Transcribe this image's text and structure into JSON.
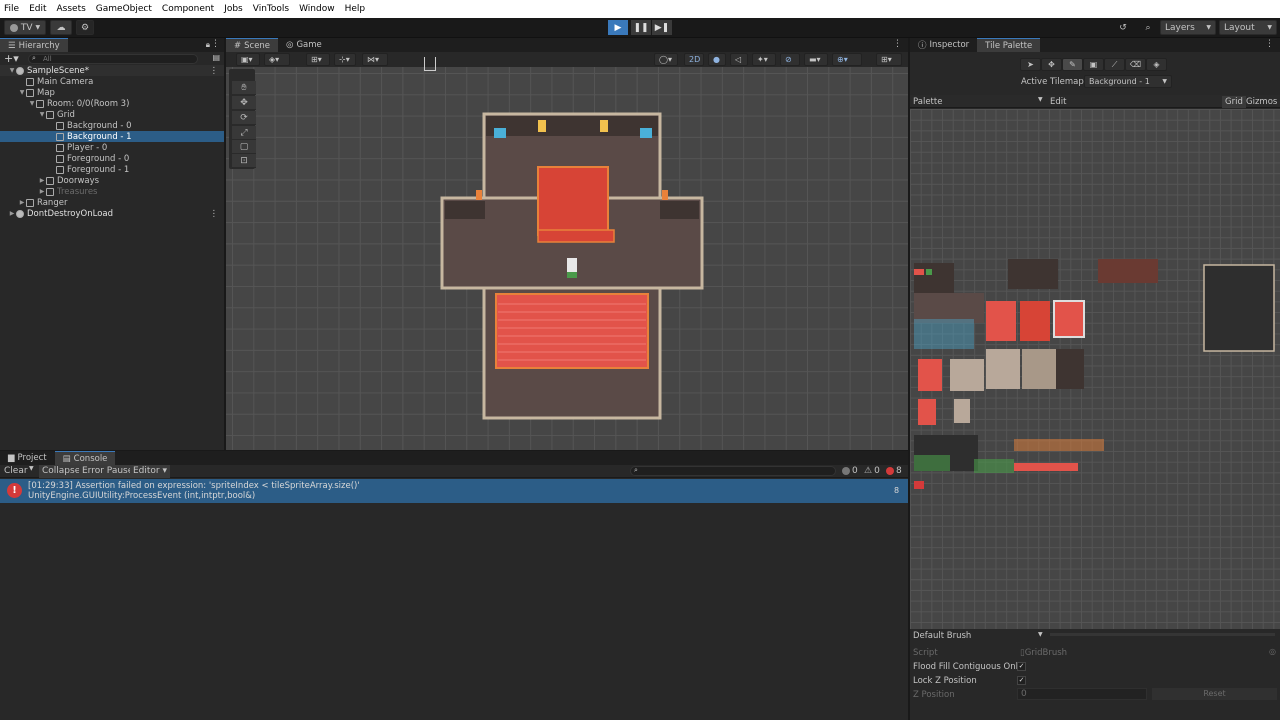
{
  "menu": [
    "File",
    "Edit",
    "Assets",
    "GameObject",
    "Component",
    "Jobs",
    "VinTools",
    "Window",
    "Help"
  ],
  "toolbar": {
    "account": "TV",
    "layers": "Layers",
    "layout": "Layout"
  },
  "hierarchy": {
    "tab": "Hierarchy",
    "search_placeholder": "All",
    "items": [
      {
        "label": "SampleScene*",
        "depth": 0,
        "kind": "scene",
        "expanded": true
      },
      {
        "label": "Main Camera",
        "depth": 1,
        "kind": "obj"
      },
      {
        "label": "Map",
        "depth": 1,
        "kind": "obj",
        "expanded": true
      },
      {
        "label": "Room: 0/0(Room 3)",
        "depth": 2,
        "kind": "obj",
        "expanded": true
      },
      {
        "label": "Grid",
        "depth": 3,
        "kind": "obj",
        "expanded": true
      },
      {
        "label": "Background - 0",
        "depth": 4,
        "kind": "obj"
      },
      {
        "label": "Background - 1",
        "depth": 4,
        "kind": "obj",
        "selected": true
      },
      {
        "label": "Player - 0",
        "depth": 4,
        "kind": "obj"
      },
      {
        "label": "Foreground - 0",
        "depth": 4,
        "kind": "obj"
      },
      {
        "label": "Foreground - 1",
        "depth": 4,
        "kind": "obj"
      },
      {
        "label": "Doorways",
        "depth": 3,
        "kind": "obj",
        "collapsed": true
      },
      {
        "label": "Treasures",
        "depth": 3,
        "kind": "obj",
        "collapsed": true,
        "dim": true
      },
      {
        "label": "Ranger",
        "depth": 1,
        "kind": "obj",
        "collapsed": true
      },
      {
        "label": "DontDestroyOnLoad",
        "depth": 0,
        "kind": "scene",
        "collapsed": true
      }
    ]
  },
  "scene": {
    "tabs": [
      "Scene",
      "Game"
    ],
    "mode_2d": "2D"
  },
  "console": {
    "tabs": [
      "Project",
      "Console"
    ],
    "buttons": [
      "Clear",
      "Collapse",
      "Error Pause",
      "Editor"
    ],
    "counts": {
      "log": "0",
      "warn": "0",
      "error": "8"
    },
    "message_line1": "[01:29:33] Assertion failed on expression: 'spriteIndex < tileSpriteArray.size()'",
    "message_line2": "UnityEngine.GUIUtility:ProcessEvent (int,intptr,bool&)",
    "message_count": "8"
  },
  "inspector": {
    "tabs": [
      "Inspector",
      "Tile Palette"
    ],
    "active_tilemap_label": "Active Tilemap",
    "active_tilemap_value": "Background - 1",
    "palette_label": "Palette",
    "edit_label": "Edit",
    "grid_label": "Grid",
    "gizmos_label": "Gizmos",
    "brush": "Default Brush",
    "script_label": "Script",
    "script_value": "GridBrush",
    "flood_label": "Flood Fill Contiguous Only",
    "lockz_label": "Lock Z Position",
    "zpos_label": "Z Position",
    "zpos_value": "0",
    "reset_label": "Reset"
  },
  "colors": {
    "accent": "#3a79bb",
    "selection": "#2c5d87",
    "error": "#d43a3a",
    "scene_bg": "#464646"
  }
}
